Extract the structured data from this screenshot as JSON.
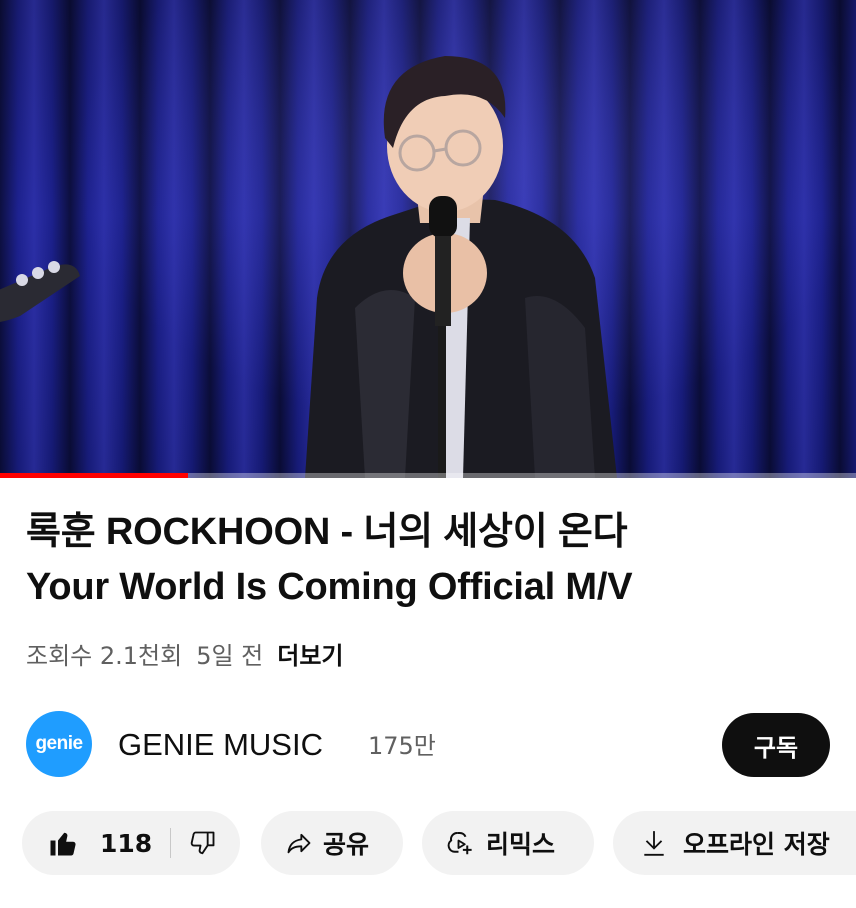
{
  "video": {
    "progress_fraction": 0.22,
    "buffer_fraction": 0.0
  },
  "title": {
    "line1": "록훈 ROCKHOON - 너의 세상이 온다",
    "line2": "Your World Is Coming Official M/V"
  },
  "meta": {
    "views": "조회수 2.1천회",
    "age": "5일 전",
    "more_label": "더보기"
  },
  "channel": {
    "avatar_text": "genie",
    "name": "GENIE MUSIC",
    "subscribers": "175만",
    "subscribe_label": "구독",
    "brand_color": "#1f9dff"
  },
  "actions": {
    "like_count": "118",
    "share_label": "공유",
    "remix_label": "리믹스",
    "offline_label": "오프라인 저장"
  },
  "icons": {
    "like": "thumbs-up-icon",
    "dislike": "thumbs-down-icon",
    "share": "share-arrow-icon",
    "remix": "remix-icon",
    "download": "download-icon"
  }
}
